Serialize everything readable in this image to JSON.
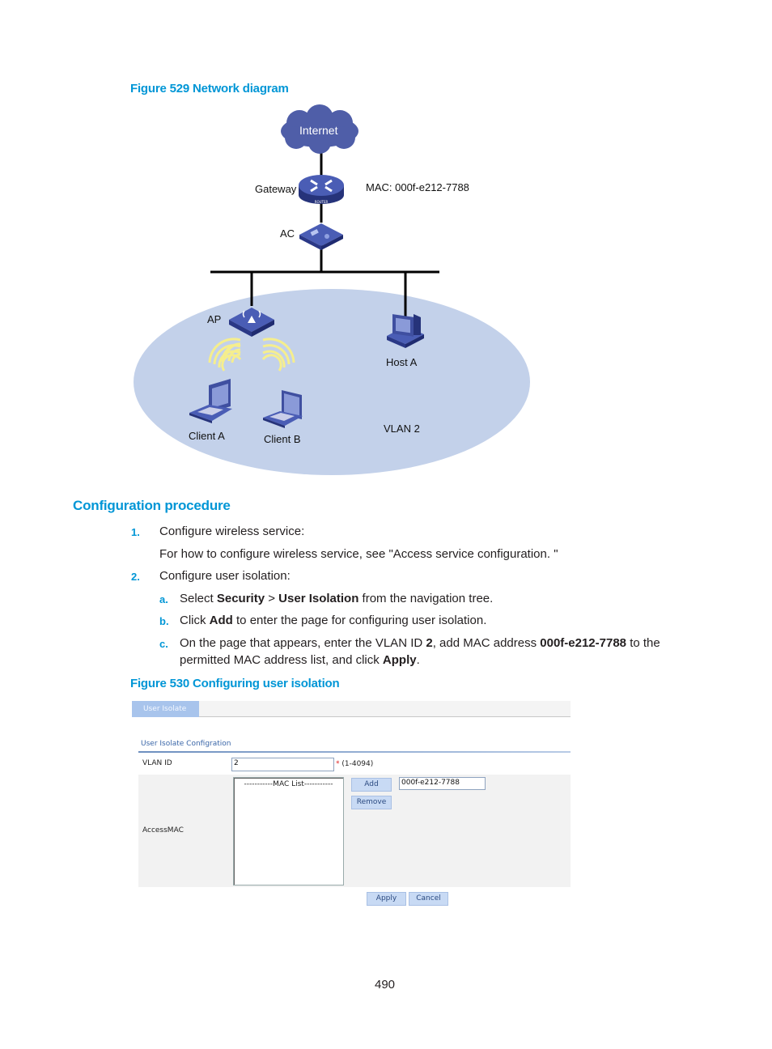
{
  "figure529": {
    "caption": "Figure 529 Network diagram",
    "nodes": {
      "internet": "Internet",
      "gateway": "Gateway",
      "gateway_mac": "MAC: 000f-e212-7788",
      "router_badge": "ROUTER",
      "ac": "AC",
      "ap": "AP",
      "host_a": "Host A",
      "client_a": "Client A",
      "client_b": "Client B",
      "vlan": "VLAN 2"
    },
    "colors": {
      "device_blue": "#3f4fa0",
      "vlan_area": "#c3d1ea",
      "wireless_wave": "#f5ee8e",
      "cloud": "#4f5ea8"
    }
  },
  "section": {
    "title": "Configuration procedure",
    "steps": [
      {
        "num": "1.",
        "text": "Configure wireless service:",
        "detail": "For how to configure wireless service, see \"Access service configuration. \""
      },
      {
        "num": "2.",
        "text": "Configure user isolation:",
        "substeps": [
          {
            "letter": "a.",
            "pre": "Select ",
            "b1": "Security",
            "mid": " > ",
            "b2": "User Isolation",
            "post": " from the navigation tree."
          },
          {
            "letter": "b.",
            "pre": "Click ",
            "b1": "Add",
            "post": " to enter the page for configuring user isolation."
          },
          {
            "letter": "c.",
            "pre": "On the page that appears, enter the VLAN ID ",
            "b1": "2",
            "mid": ", add MAC address ",
            "b2": "000f-e212-7788",
            "post": " to the",
            "line2_pre": "permitted MAC address list, and click ",
            "line2_b": "Apply",
            "line2_post": "."
          }
        ]
      }
    ]
  },
  "figure530": {
    "caption": "Figure 530 Configuring user isolation",
    "tab_label": "User Isolate",
    "section_title": "User Isolate Configration",
    "vlan_label": "VLAN ID",
    "vlan_value": "2",
    "vlan_required": "*",
    "vlan_range": "(1-4094)",
    "access_mac_label": "AccessMAC",
    "mac_list_header": "-----------MAC List-----------",
    "add_button": "Add",
    "remove_button": "Remove",
    "mac_input_value": "000f-e212-7788",
    "apply_button": "Apply",
    "cancel_button": "Cancel"
  },
  "page_number": "490"
}
